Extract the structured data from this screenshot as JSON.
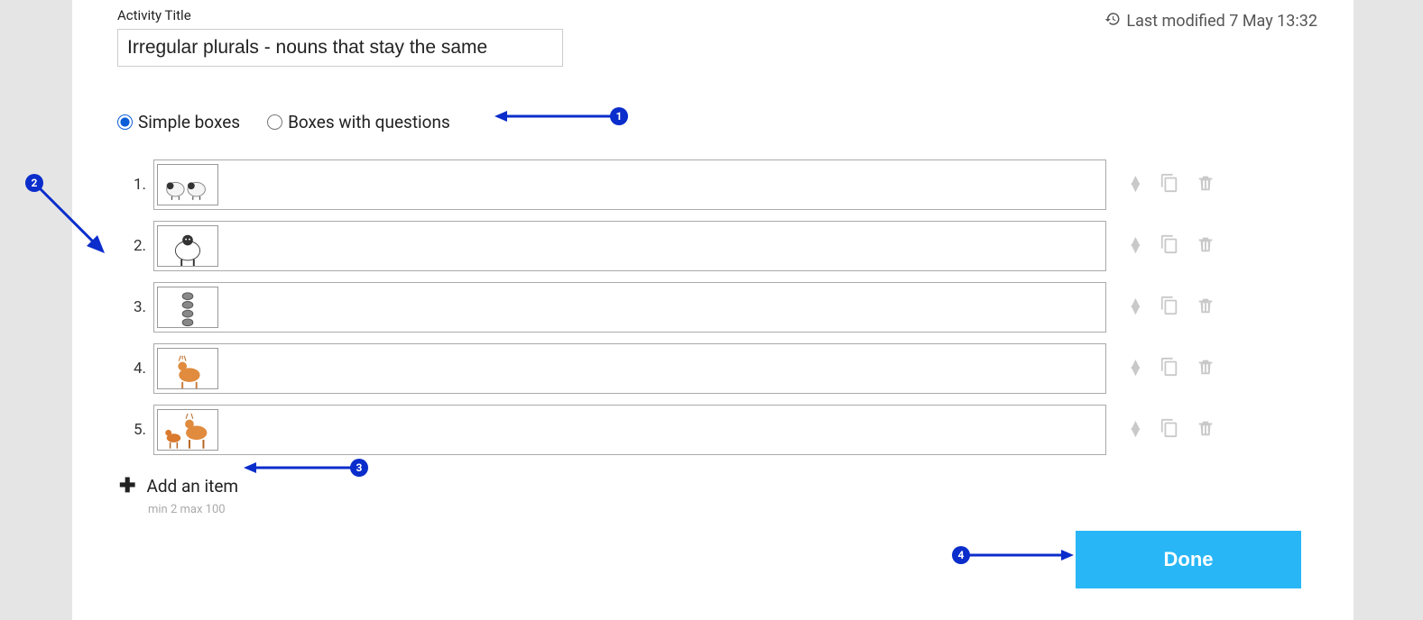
{
  "header": {
    "title_label": "Activity Title",
    "title_value": "Irregular plurals - nouns that stay the same",
    "last_modified": "Last modified 7 May 13:32"
  },
  "options": {
    "simple_boxes_label": "Simple boxes",
    "boxes_with_questions_label": "Boxes with questions",
    "selected": "simple"
  },
  "items": [
    {
      "num": "1.",
      "image": "sheep-pair"
    },
    {
      "num": "2.",
      "image": "sheep-single"
    },
    {
      "num": "3.",
      "image": "deer-stacked"
    },
    {
      "num": "4.",
      "image": "deer-single"
    },
    {
      "num": "5.",
      "image": "deer-family"
    }
  ],
  "add": {
    "label": "Add an item",
    "hint": "min 2  max 100"
  },
  "actions": {
    "done_label": "Done"
  },
  "callouts": [
    "1",
    "2",
    "3",
    "4"
  ]
}
